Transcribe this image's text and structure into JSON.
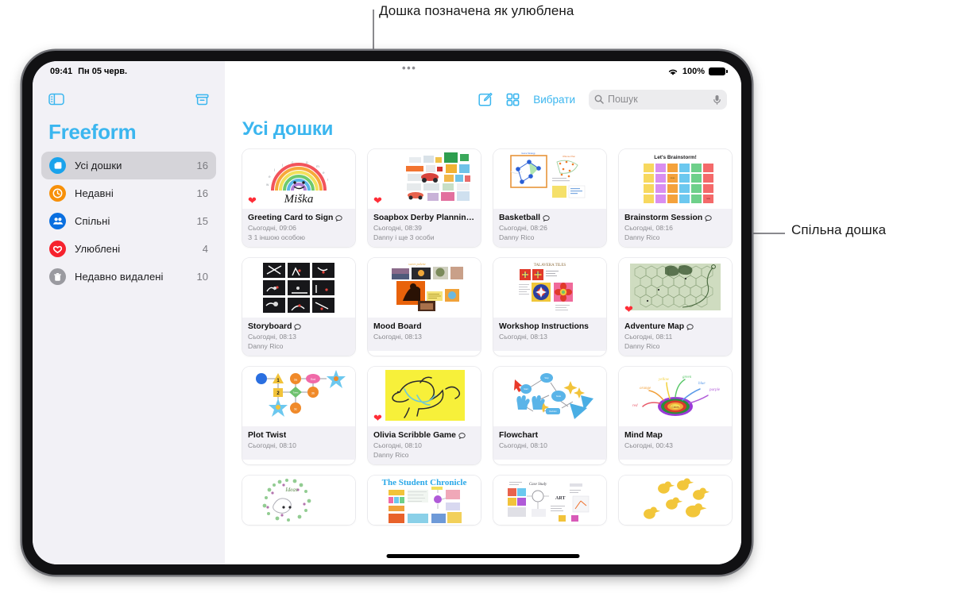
{
  "annotations": [
    {
      "id": "fav",
      "text": "Дошка позначена як улюблена"
    },
    {
      "id": "shared",
      "text": "Спільна дошка"
    }
  ],
  "status_bar": {
    "time": "09:41",
    "date": "Пн 05 черв.",
    "battery_percent": "100%",
    "wifi_icon": "wifi-icon",
    "battery_icon": "battery-icon",
    "multitask_handle": "•••"
  },
  "sidebar": {
    "app_title": "Freeform",
    "toolbar": {
      "sidebar_toggle_icon": "sidebar-toggle-icon",
      "new_folder_icon": "new-folder-icon"
    },
    "items": [
      {
        "label": "Усі дошки",
        "count": "16",
        "icon": "all-boards-icon",
        "color": "#1aa3ec",
        "active": true
      },
      {
        "label": "Недавні",
        "count": "16",
        "icon": "clock-icon",
        "color": "#f79009",
        "active": false
      },
      {
        "label": "Спільні",
        "count": "15",
        "icon": "people-icon",
        "color": "#0a6fe0",
        "active": false
      },
      {
        "label": "Улюблені",
        "count": "4",
        "icon": "heart-icon",
        "color": "#f6222e",
        "active": false
      },
      {
        "label": "Недавно видалені",
        "count": "10",
        "icon": "trash-icon",
        "color": "#9a9aa0",
        "active": false
      }
    ]
  },
  "content": {
    "title": "Усі дошки",
    "toolbar": {
      "compose_label": "compose-icon",
      "grid_view_label": "grid-view-icon",
      "select_label": "Вибрати"
    },
    "search": {
      "placeholder": "Пошук",
      "value": "",
      "search_icon": "search-icon",
      "mic_icon": "microphone-icon"
    },
    "boards": [
      {
        "title": "Greeting Card to Sign",
        "date": "Сьогодні, 09:06",
        "people": "З 1 іншою особою",
        "favorite": true,
        "shared": true,
        "art": "rainbow"
      },
      {
        "title": "Soapbox Derby Plannin…",
        "date": "Сьогодні, 08:39",
        "people": "Danny і ще 3 особи",
        "favorite": true,
        "shared": false,
        "art": "collage"
      },
      {
        "title": "Basketball",
        "date": "Сьогодні, 08:26",
        "people": "Danny Rico",
        "favorite": false,
        "shared": true,
        "art": "court"
      },
      {
        "title": "Brainstorm Session",
        "date": "Сьогодні, 08:16",
        "people": "Danny Rico",
        "favorite": false,
        "shared": true,
        "art": "stickies"
      },
      {
        "title": "Storyboard",
        "date": "Сьогодні, 08:13",
        "people": "Danny Rico",
        "favorite": false,
        "shared": true,
        "art": "storyboard"
      },
      {
        "title": "Mood Board",
        "date": "Сьогодні, 08:13",
        "people": "",
        "favorite": false,
        "shared": false,
        "art": "mood"
      },
      {
        "title": "Workshop Instructions",
        "date": "Сьогодні, 08:13",
        "people": "",
        "favorite": false,
        "shared": false,
        "art": "tiles"
      },
      {
        "title": "Adventure Map",
        "date": "Сьогодні, 08:11",
        "people": "Danny Rico",
        "favorite": true,
        "shared": true,
        "art": "map"
      },
      {
        "title": "Plot Twist",
        "date": "Сьогодні, 08:10",
        "people": "",
        "favorite": false,
        "shared": false,
        "art": "plot"
      },
      {
        "title": "Olivia Scribble Game",
        "date": "Сьогодні, 08:10",
        "people": "Danny Rico",
        "favorite": true,
        "shared": true,
        "art": "scribble"
      },
      {
        "title": "Flowchart",
        "date": "Сьогодні, 08:10",
        "people": "",
        "favorite": false,
        "shared": false,
        "art": "flowchart"
      },
      {
        "title": "Mind Map",
        "date": "Сьогодні, 00:43",
        "people": "",
        "favorite": false,
        "shared": false,
        "art": "mindmap"
      }
    ],
    "partial_row_titles": [
      "",
      "The Student Chronicle",
      "",
      ""
    ],
    "colors": {
      "accent": "#3bb6ef",
      "favorite_heart": "#ff2d37",
      "sidebar_bg": "#f2f1f6",
      "card_meta_bg": "#f2f1f6"
    }
  }
}
